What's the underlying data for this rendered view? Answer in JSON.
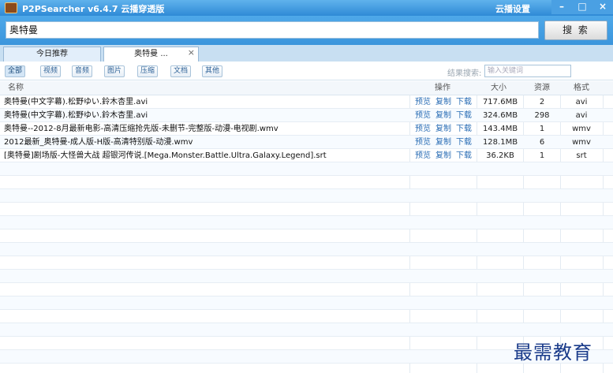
{
  "window": {
    "title": "P2PSearcher v6.4.7 云播穿透版",
    "cloud_settings": "云播设置",
    "minimize": "–",
    "maximize": "□",
    "close": "×"
  },
  "search": {
    "query": "奥特曼",
    "button_label": "搜 索"
  },
  "tabs": [
    {
      "label": "今日推荐"
    },
    {
      "label": "奥特曼 ...",
      "close": "×"
    }
  ],
  "filters": [
    {
      "label": "全部"
    },
    {
      "label": "视频"
    },
    {
      "label": "音频"
    },
    {
      "label": "图片"
    },
    {
      "label": "压缩"
    },
    {
      "label": "文档"
    },
    {
      "label": "其他"
    }
  ],
  "result_search": {
    "label": "结果搜索:",
    "placeholder": "输入关键词"
  },
  "table": {
    "headers": {
      "name": "名称",
      "actions": "操作",
      "size": "大小",
      "sources": "资源",
      "format": "格式"
    },
    "action_labels": {
      "preview": "预览",
      "copy": "复制",
      "download": "下载"
    },
    "rows": [
      {
        "name": "奥特曼(中文字幕).松野ゆい.鈴木杏里.avi",
        "size": "717.6MB",
        "sources": "2",
        "format": "avi"
      },
      {
        "name": "奥特曼(中文字幕).松野ゆい.鈴木杏里.avi",
        "size": "324.6MB",
        "sources": "298",
        "format": "avi"
      },
      {
        "name": "奥特曼--2012-8月最新电影-高清压缩抢先版-未删节-完整版-动漫-电视剧.wmv",
        "size": "143.4MB",
        "sources": "1",
        "format": "wmv"
      },
      {
        "name": "2012最新_奥特曼-成人版-H版-高清特别版-动漫.wmv",
        "size": "128.1MB",
        "sources": "6",
        "format": "wmv"
      },
      {
        "name": "[奥特曼]剧场版-大怪兽大战 超银河传说.[Mega.Monster.Battle.Ultra.Galaxy.Legend].srt",
        "size": "36.2KB",
        "sources": "1",
        "format": "srt"
      }
    ]
  },
  "watermark": "最需教育"
}
